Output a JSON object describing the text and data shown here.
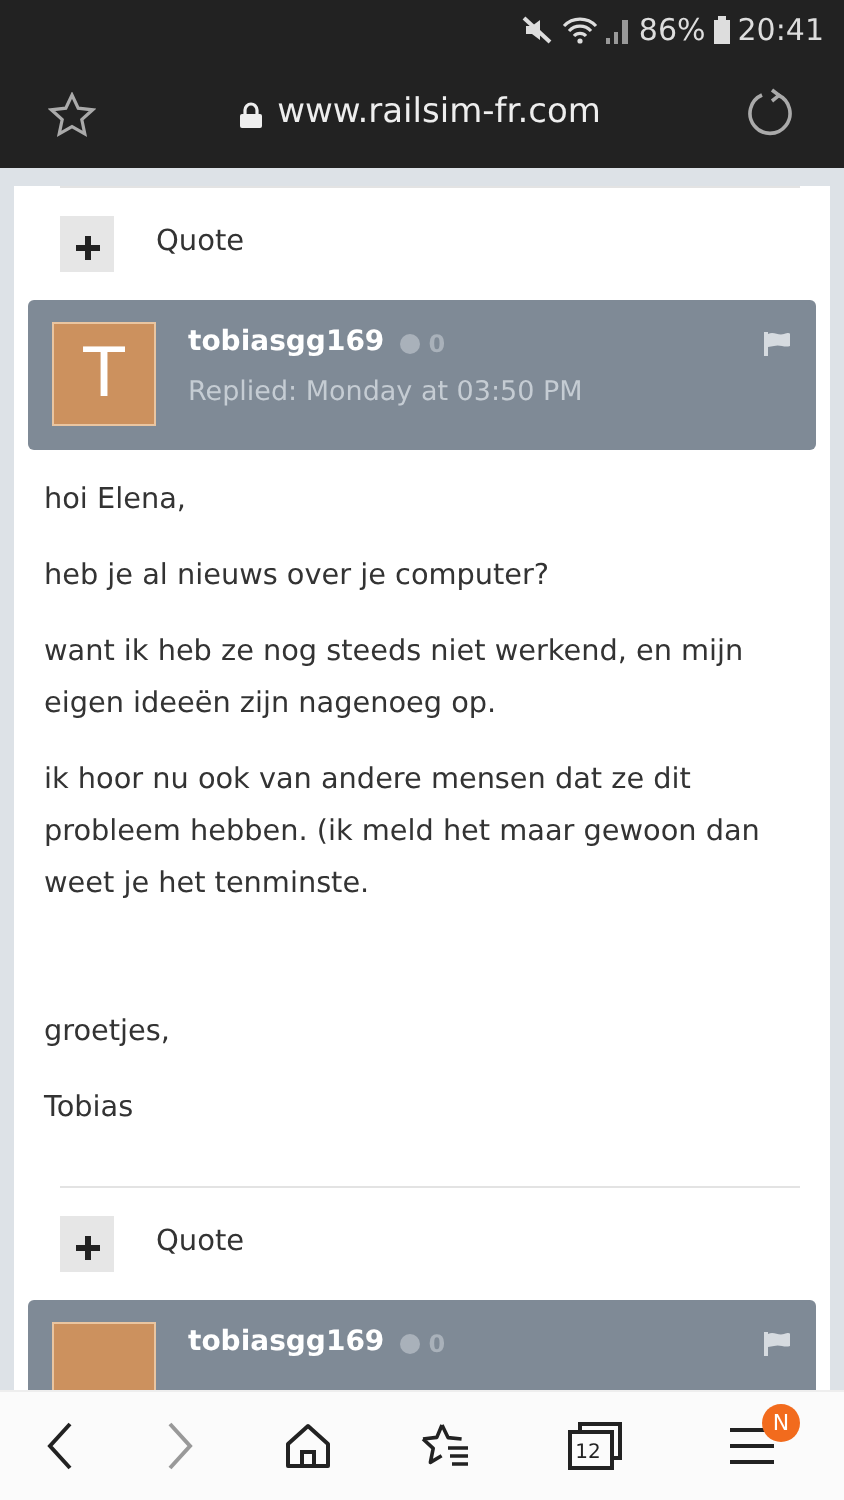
{
  "status_bar": {
    "battery": "86%",
    "time": "20:41"
  },
  "address_bar": {
    "url": "www.railsim-fr.com"
  },
  "thread": [
    {
      "kind": "quote_bar",
      "label": "Quote"
    },
    {
      "kind": "post_header",
      "avatar_letter": "T",
      "author": "tobiasgg169",
      "reputation": "0",
      "replied": "Replied: Monday at 03:50 PM"
    },
    {
      "kind": "post_body",
      "sections": [
        {
          "paragraphs": [
            "hoi Elena,",
            "heb je al nieuws over je computer?",
            "want ik heb ze nog steeds niet werkend, en mijn eigen ideeën zijn nagenoeg op.",
            "ik hoor nu ook van andere mensen dat ze dit probleem hebben. (ik meld het maar gewoon dan weet je het tenminste."
          ]
        },
        {
          "paragraphs": [
            "groetjes,",
            "Tobias"
          ]
        }
      ]
    },
    {
      "kind": "quote_bar",
      "label": "Quote"
    },
    {
      "kind": "post_header",
      "author": "tobiasgg169",
      "reputation": "0"
    }
  ],
  "bottom_nav": [
    {
      "kind": "back",
      "disabled": false
    },
    {
      "kind": "forward",
      "disabled": true
    },
    {
      "kind": "home",
      "disabled": false
    },
    {
      "kind": "bookmarks",
      "disabled": false
    },
    {
      "kind": "tabs",
      "disabled": false,
      "count": "12"
    },
    {
      "kind": "menu",
      "disabled": false,
      "badge": "N"
    }
  ]
}
